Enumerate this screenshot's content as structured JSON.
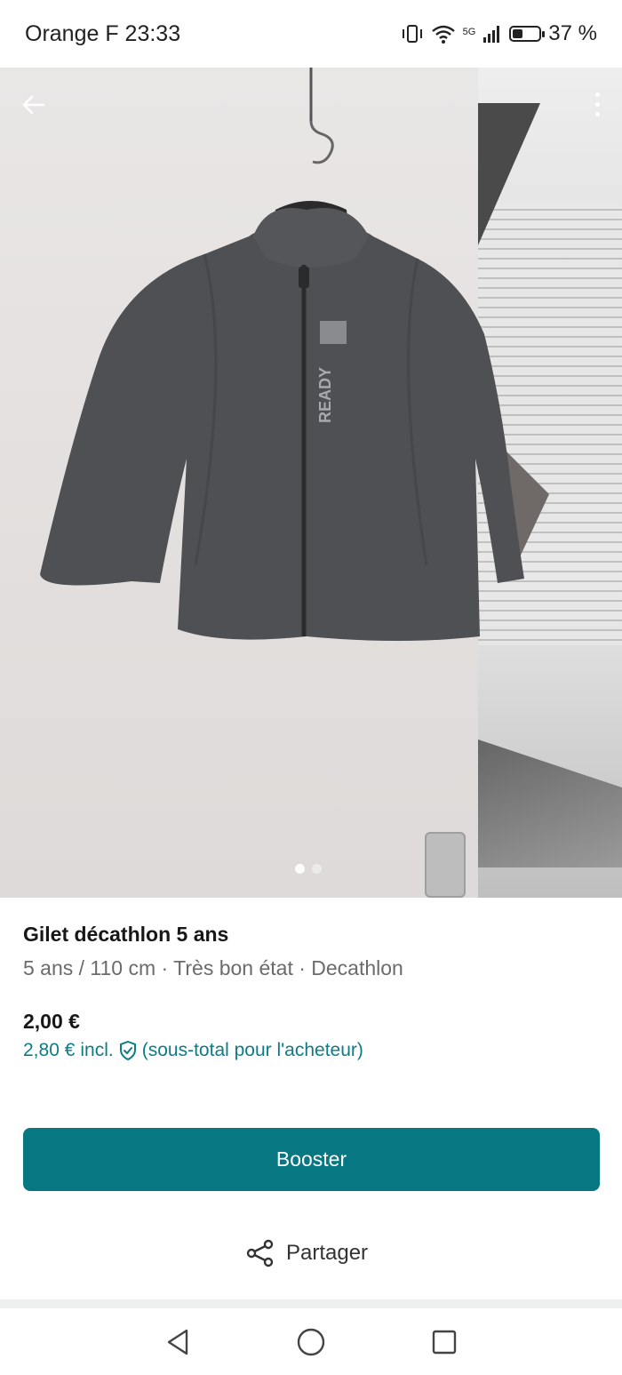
{
  "status_bar": {
    "carrier_time": "Orange F 23:33",
    "network": "5G",
    "battery_percent": "37 %",
    "battery_level": 0.37
  },
  "photo": {
    "image_count": 2,
    "current_index": 0,
    "print_text": "READY"
  },
  "item": {
    "title": "Gilet décathlon 5 ans",
    "subtitle": "5 ans / 110 cm · Très bon état · Decathlon",
    "price": "2,00 €",
    "buyer_price_amount": "2,80 €",
    "buyer_price_incl": "incl.",
    "buyer_price_note": "(sous-total pour l'acheteur)"
  },
  "actions": {
    "booster_label": "Booster",
    "share_label": "Partager"
  },
  "colors": {
    "accent": "#077782",
    "buyer_price": "#0e7c86",
    "jacket": "#4f5053"
  },
  "icons": {
    "back": "arrow-left-icon",
    "more": "more-vertical-icon",
    "shield": "shield-check-icon",
    "share": "share-icon",
    "nav_back": "triangle-back-icon",
    "nav_home": "circle-home-icon",
    "nav_recents": "square-recents-icon"
  }
}
